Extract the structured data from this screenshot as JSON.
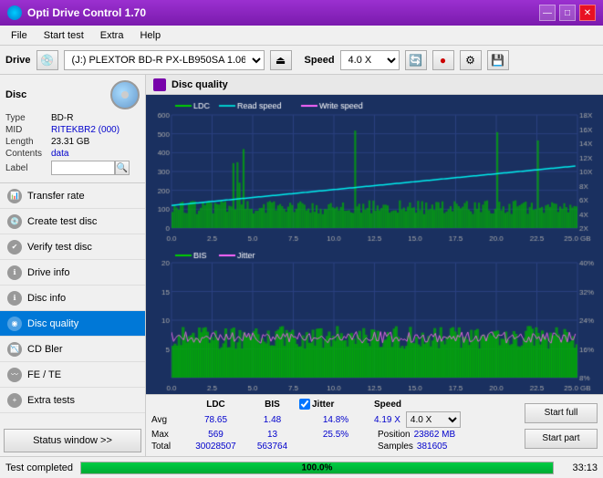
{
  "app": {
    "title": "Opti Drive Control 1.70",
    "icon": "disc-icon"
  },
  "titlebar": {
    "minimize_label": "—",
    "maximize_label": "□",
    "close_label": "✕"
  },
  "menu": {
    "items": [
      "File",
      "Start test",
      "Extra",
      "Help"
    ]
  },
  "toolbar": {
    "drive_label": "Drive",
    "drive_value": "(J:)  PLEXTOR BD-R  PX-LB950SA 1.06",
    "speed_label": "Speed",
    "speed_value": "4.0 X"
  },
  "disc": {
    "section_label": "Disc",
    "type_label": "Type",
    "type_value": "BD-R",
    "mid_label": "MID",
    "mid_value": "RITEKBR2 (000)",
    "length_label": "Length",
    "length_value": "23.31 GB",
    "contents_label": "Contents",
    "contents_value": "data",
    "label_label": "Label",
    "label_value": ""
  },
  "nav": {
    "items": [
      {
        "id": "transfer-rate",
        "label": "Transfer rate",
        "active": false
      },
      {
        "id": "create-test-disc",
        "label": "Create test disc",
        "active": false
      },
      {
        "id": "verify-test-disc",
        "label": "Verify test disc",
        "active": false
      },
      {
        "id": "drive-info",
        "label": "Drive info",
        "active": false
      },
      {
        "id": "disc-info",
        "label": "Disc info",
        "active": false
      },
      {
        "id": "disc-quality",
        "label": "Disc quality",
        "active": true
      },
      {
        "id": "cd-bler",
        "label": "CD Bler",
        "active": false
      },
      {
        "id": "fe-te",
        "label": "FE / TE",
        "active": false
      },
      {
        "id": "extra-tests",
        "label": "Extra tests",
        "active": false
      }
    ],
    "status_btn": "Status window >>"
  },
  "chart": {
    "title": "Disc quality",
    "legend_top": [
      {
        "id": "ldc",
        "label": "LDC",
        "color": "#00cc00"
      },
      {
        "id": "read-speed",
        "label": "Read speed",
        "color": "#00ffff"
      },
      {
        "id": "write-speed",
        "label": "Write speed",
        "color": "#ff66ff"
      }
    ],
    "legend_bottom": [
      {
        "id": "bis",
        "label": "BIS",
        "color": "#00cc00"
      },
      {
        "id": "jitter",
        "label": "Jitter",
        "color": "#ff66ff"
      }
    ],
    "top_y_left": [
      "600",
      "500",
      "400",
      "300",
      "200",
      "100",
      "0"
    ],
    "top_y_right": [
      "18X",
      "16X",
      "14X",
      "12X",
      "10X",
      "8X",
      "6X",
      "4X",
      "2X"
    ],
    "bottom_y_left": [
      "20",
      "15",
      "10",
      "5"
    ],
    "bottom_y_right": [
      "40%",
      "32%",
      "24%",
      "16%",
      "8%"
    ],
    "x_labels": [
      "0.0",
      "2.5",
      "5.0",
      "7.5",
      "10.0",
      "12.5",
      "15.0",
      "17.5",
      "20.0",
      "22.5",
      "25.0 GB"
    ]
  },
  "stats": {
    "ldc_label": "LDC",
    "bis_label": "BIS",
    "jitter_label": "Jitter",
    "jitter_checked": true,
    "speed_label": "Speed",
    "avg_label": "Avg",
    "max_label": "Max",
    "total_label": "Total",
    "ldc_avg": "78.65",
    "ldc_max": "569",
    "ldc_total": "30028507",
    "bis_avg": "1.48",
    "bis_max": "13",
    "bis_total": "563764",
    "jitter_avg": "14.8%",
    "jitter_max": "25.5%",
    "speed_avg": "4.19 X",
    "speed_dropdown": "4.0 X",
    "position_label": "Position",
    "position_val": "23862 MB",
    "samples_label": "Samples",
    "samples_val": "381605",
    "start_full_label": "Start full",
    "start_part_label": "Start part"
  },
  "statusbar": {
    "status_text": "Test completed",
    "progress_pct": 100,
    "progress_text": "100.0%",
    "time_text": "33:13"
  }
}
